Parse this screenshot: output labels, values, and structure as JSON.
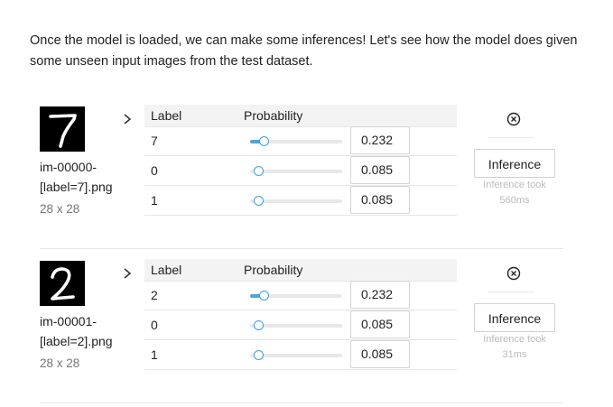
{
  "intro_text": "Once the model is loaded, we can make some inferences! Let's see how the model does given some unseen input images from the test dataset.",
  "table_headers": {
    "label": "Label",
    "probability": "Probability"
  },
  "inference_button_label": "Inference",
  "colors": {
    "accent": "#49a7e0",
    "header_bg": "#f3f3f3",
    "muted_text": "#bbbbbb"
  },
  "icons": {
    "expand": "chevron-right-icon",
    "remove": "close-circle-icon"
  },
  "samples": [
    {
      "digit": "7",
      "filename_line1": "im-00000-",
      "filename_line2": "[label=7].png",
      "dimensions": "28 x 28",
      "predictions": [
        {
          "label": "7",
          "probability": 0.232,
          "probability_text": "0.232"
        },
        {
          "label": "0",
          "probability": 0.085,
          "probability_text": "0.085"
        },
        {
          "label": "1",
          "probability": 0.085,
          "probability_text": "0.085"
        }
      ],
      "inference_took": "Inference took",
      "inference_time": "560ms"
    },
    {
      "digit": "2",
      "filename_line1": "im-00001-",
      "filename_line2": "[label=2].png",
      "dimensions": "28 x 28",
      "predictions": [
        {
          "label": "2",
          "probability": 0.232,
          "probability_text": "0.232"
        },
        {
          "label": "0",
          "probability": 0.085,
          "probability_text": "0.085"
        },
        {
          "label": "1",
          "probability": 0.085,
          "probability_text": "0.085"
        }
      ],
      "inference_took": "Inference took",
      "inference_time": "31ms"
    }
  ]
}
